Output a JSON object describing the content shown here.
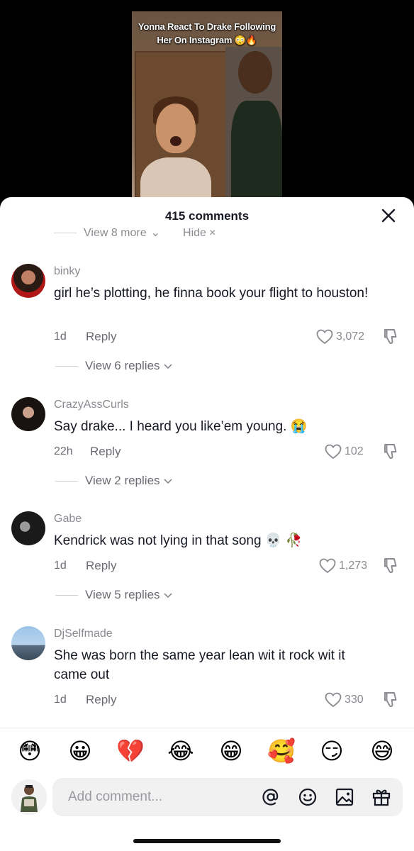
{
  "video": {
    "title_line1": "Yonna React To Drake Following",
    "title_line2": "Her On Instagram 😳🔥"
  },
  "sheet": {
    "comment_count": "415 comments",
    "cut_view_more": "View 8 more",
    "cut_hide": "Hide"
  },
  "comments": [
    {
      "username": "binky",
      "text": "girl he’s plotting, he finna book your flight to houston!",
      "time": "1d",
      "reply": "Reply",
      "likes": "3,072",
      "view_replies": "View 6 replies"
    },
    {
      "username": "CrazyAssCurls",
      "text": "Say drake... I heard you like’em young. 😭",
      "time": "22h",
      "reply": "Reply",
      "likes": "102",
      "view_replies": "View 2 replies"
    },
    {
      "username": "Gabe",
      "text": "Kendrick was not lying in that song 💀 🥀",
      "time": "1d",
      "reply": "Reply",
      "likes": "1,273",
      "view_replies": "View 5 replies"
    },
    {
      "username": "DjSelfmade",
      "text": "She was born the same year lean wit it rock wit it came out",
      "time": "1d",
      "reply": "Reply",
      "likes": "330"
    }
  ],
  "emojis": [
    "😳",
    "😀",
    "💔",
    "😂",
    "😁",
    "🥰",
    "😏",
    "😅"
  ],
  "composer": {
    "placeholder": "Add comment..."
  },
  "icons": {
    "close": "close-icon",
    "like": "heart-outline-icon",
    "dislike": "thumbs-down-icon",
    "chevron": "chevron-down-icon",
    "mention": "at-icon",
    "emoji": "smiley-icon",
    "image": "image-icon",
    "gift": "gift-icon"
  }
}
